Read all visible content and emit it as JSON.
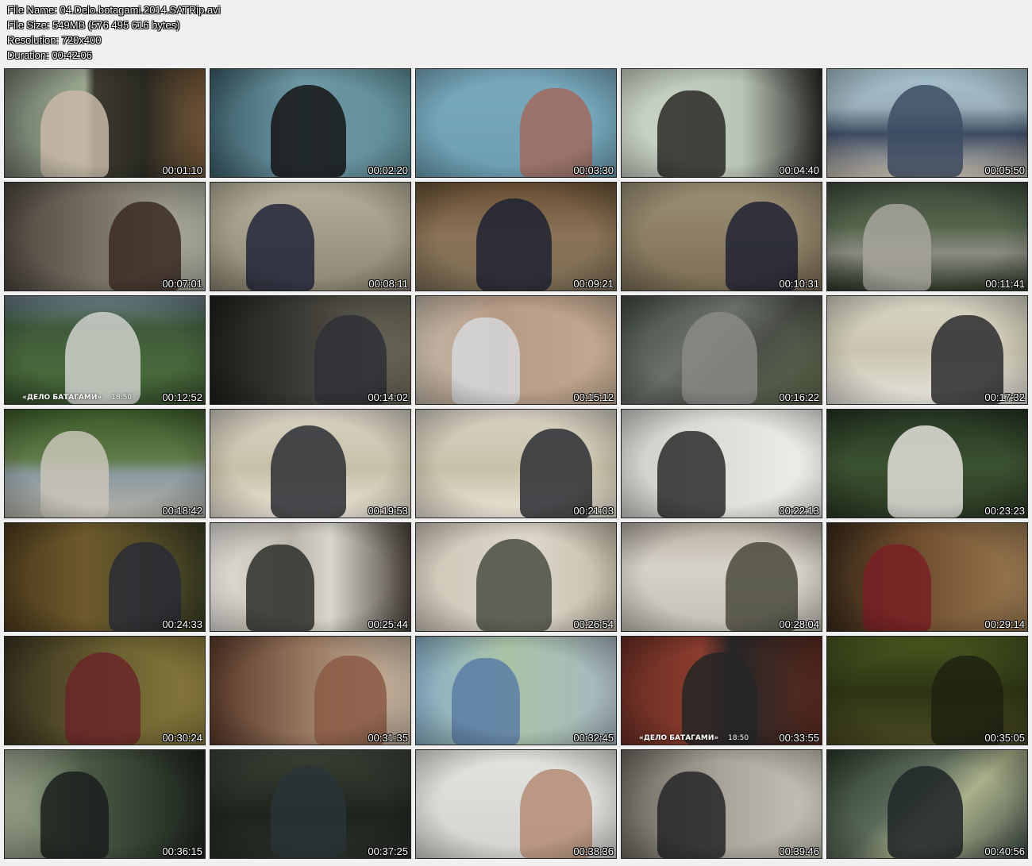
{
  "header": {
    "file_name": "File Name: 04.Delo.botagami.2014.SATRip.avi",
    "file_size": "File Size: 549MB (576 495 616 bytes)",
    "resolution": "Resolution: 720x400",
    "duration": "Duration: 00:42:06"
  },
  "thumbnails": [
    {
      "time": "00:01:10",
      "bg": "linear-gradient(90deg,#6f7a6a 0%,#9aa690 40%,#3c3a2e 45%,#2b2a22 70%,#7a5a3a 100%)",
      "fig": "#c8b8a8"
    },
    {
      "time": "00:02:20",
      "bg": "linear-gradient(90deg,#3d5e6a 0%,#6d98a4 45%,#5f8d98 100%)",
      "fig": "#151515"
    },
    {
      "time": "00:03:30",
      "bg": "linear-gradient(180deg,#78a9bd 0%,#6d9fb2 100%)",
      "fig": "#a26a5e"
    },
    {
      "time": "00:04:40",
      "bg": "linear-gradient(90deg,#c9d4c5 0%,#b9c5b6 60%,#2a2a26 100%)",
      "fig": "#2a2a26"
    },
    {
      "time": "00:05:50",
      "bg": "linear-gradient(180deg,#a8c4cf 0%,#9bb0ba 35%,#3e4c63 60%,#c9c3b3 100%)",
      "fig": "#3e4c63"
    },
    {
      "time": "00:07:01",
      "bg": "linear-gradient(90deg,#4c463c 0%,#837e70 60%,#aeb0a0 100%)",
      "fig": "#3a2a22"
    },
    {
      "time": "00:08:11",
      "bg": "linear-gradient(180deg,#b5b09b 0%,#8d8672 100%)",
      "fig": "#22263a"
    },
    {
      "time": "00:09:21",
      "bg": "linear-gradient(180deg,#6a5136 0%,#8a7356 50%,#7d6e56 100%)",
      "fig": "#1e2232"
    },
    {
      "time": "00:10:31",
      "bg": "linear-gradient(180deg,#9b8f74 0%,#7b6e55 100%)",
      "fig": "#1e2232"
    },
    {
      "time": "00:11:41",
      "bg": "linear-gradient(180deg,#3d4a3a 0%,#54654c 40%,#8a8b80 65%,#2d3a28 100%)",
      "fig": "#a7a59c"
    },
    {
      "time": "00:12:52",
      "bg": "linear-gradient(180deg,#6a7d8a 0%,#3f5b3a 30%,#486a3c 70%,#35502c 100%)",
      "fig": "#cfd1cc",
      "overlay": "«ДЕЛО БАТАГАМИ»",
      "overlay_time": "18:50"
    },
    {
      "time": "00:14:02",
      "bg": "linear-gradient(90deg,#1f1e1b 0%,#3b3a34 45%,#6e6a5a 100%)",
      "fig": "#2e3036"
    },
    {
      "time": "00:15:12",
      "bg": "linear-gradient(90deg,#c5b8a8 0%,#b69a86 40%,#c4ab92 100%)",
      "fig": "#d6d8db"
    },
    {
      "time": "00:16:22",
      "bg": "linear-gradient(135deg,#3f4a42 0%,#6a706a 40%,#4c5048 60%,#5b6a4a 100%)",
      "fig": "#8a8a86"
    },
    {
      "time": "00:17:32",
      "bg": "linear-gradient(180deg,#d8d6c5 0%,#c9c5b0 50%,#e6e4dc 100%)",
      "fig": "#2b2b2e"
    },
    {
      "time": "00:18:42",
      "bg": "linear-gradient(180deg,#3c5a2a 0%,#607a48 45%,#8a9aa0 60%,#b7b3a9 100%)",
      "fig": "#c9c4b8"
    },
    {
      "time": "00:19:53",
      "bg": "linear-gradient(180deg,#d7d2c4 0%,#c8c0a8 55%,#ece6d8 100%)",
      "fig": "#2c2e34"
    },
    {
      "time": "00:21:03",
      "bg": "linear-gradient(180deg,#d7d2c4 0%,#c8c0a8 55%,#ece6d8 100%)",
      "fig": "#2c2e34"
    },
    {
      "time": "00:22:13",
      "bg": "linear-gradient(90deg,#cfd0c9 0%,#e2e2dc 60%,#f0f0ea 100%)",
      "fig": "#2c2b2a"
    },
    {
      "time": "00:23:23",
      "bg": "linear-gradient(180deg,#243522 0%,#3b5230 50%,#2b3a24 100%)",
      "fig": "#e3e1dc"
    },
    {
      "time": "00:24:33",
      "bg": "linear-gradient(90deg,#4d3a1c 0%,#6e5a2c 40%,#3a3c22 100%)",
      "fig": "#2a2c36"
    },
    {
      "time": "00:25:44",
      "bg": "linear-gradient(90deg,#e6e3dc 0%,#b9b4a8 40%,#d8d5cd 60%,#4a443a 100%)",
      "fig": "#2e2f2a"
    },
    {
      "time": "00:26:54",
      "bg": "linear-gradient(90deg,#cfc7b8 0%,#dcd6c9 60%,#c2b9a7 100%)",
      "fig": "#4a4e42"
    },
    {
      "time": "00:28:04",
      "bg": "linear-gradient(180deg,#b8b1a4 0%,#d6d2c7 40%,#c4c0b6 100%)",
      "fig": "#4a4a3c"
    },
    {
      "time": "00:29:14",
      "bg": "linear-gradient(90deg,#3a2a1a 0%,#6a4a2a 40%,#9a7a52 100%)",
      "fig": "#7a1e24"
    },
    {
      "time": "00:30:24",
      "bg": "linear-gradient(90deg,#3a3320 0%,#6e6432 60%,#8a7a3c 100%)",
      "fig": "#6a2628"
    },
    {
      "time": "00:31:35",
      "bg": "linear-gradient(90deg,#5a3a2a 0%,#9a7a62 50%,#c8b6a2 100%)",
      "fig": "#8a5a44"
    },
    {
      "time": "00:32:45",
      "bg": "linear-gradient(90deg,#8ab0c8 0%,#a9c2a6 45%,#a8b8c2 100%)",
      "fig": "#5b7ca6"
    },
    {
      "time": "00:33:55",
      "bg": "linear-gradient(90deg,#6a2e24 0%,#8a3c2e 40%,#262626 55%,#5a2a20 100%)",
      "fig": "#262626",
      "overlay": "«ДЕЛО БАТАГАМИ»",
      "overlay_time": "18:50"
    },
    {
      "time": "00:35:05",
      "bg": "linear-gradient(180deg,#4a5a20 0%,#2c3414 50%,#4a4a22 100%)",
      "fig": "#1e2212"
    },
    {
      "time": "00:36:15",
      "bg": "linear-gradient(90deg,#a2ab94 0%,#4a5a44 40%,#1c241c 100%)",
      "fig": "#1a1e1c"
    },
    {
      "time": "00:37:25",
      "bg": "linear-gradient(180deg,#3a4236 0%,#1c241c 60%,#2a3028 100%)",
      "fig": "#2a3436"
    },
    {
      "time": "00:38:36",
      "bg": "linear-gradient(180deg,#e2e2de 0%,#d3d3cf 100%)",
      "fig": "#b48c74"
    },
    {
      "time": "00:39:46",
      "bg": "linear-gradient(90deg,#6e6a60 0%,#a8a49a 50%,#c8c4b8 100%)",
      "fig": "#262628"
    },
    {
      "time": "00:40:56",
      "bg": "linear-gradient(135deg,#2a3a2a 0%,#5a6a5a 40%,#aab08a 60%,#3c4a44 100%)",
      "fig": "#1e2628"
    }
  ]
}
